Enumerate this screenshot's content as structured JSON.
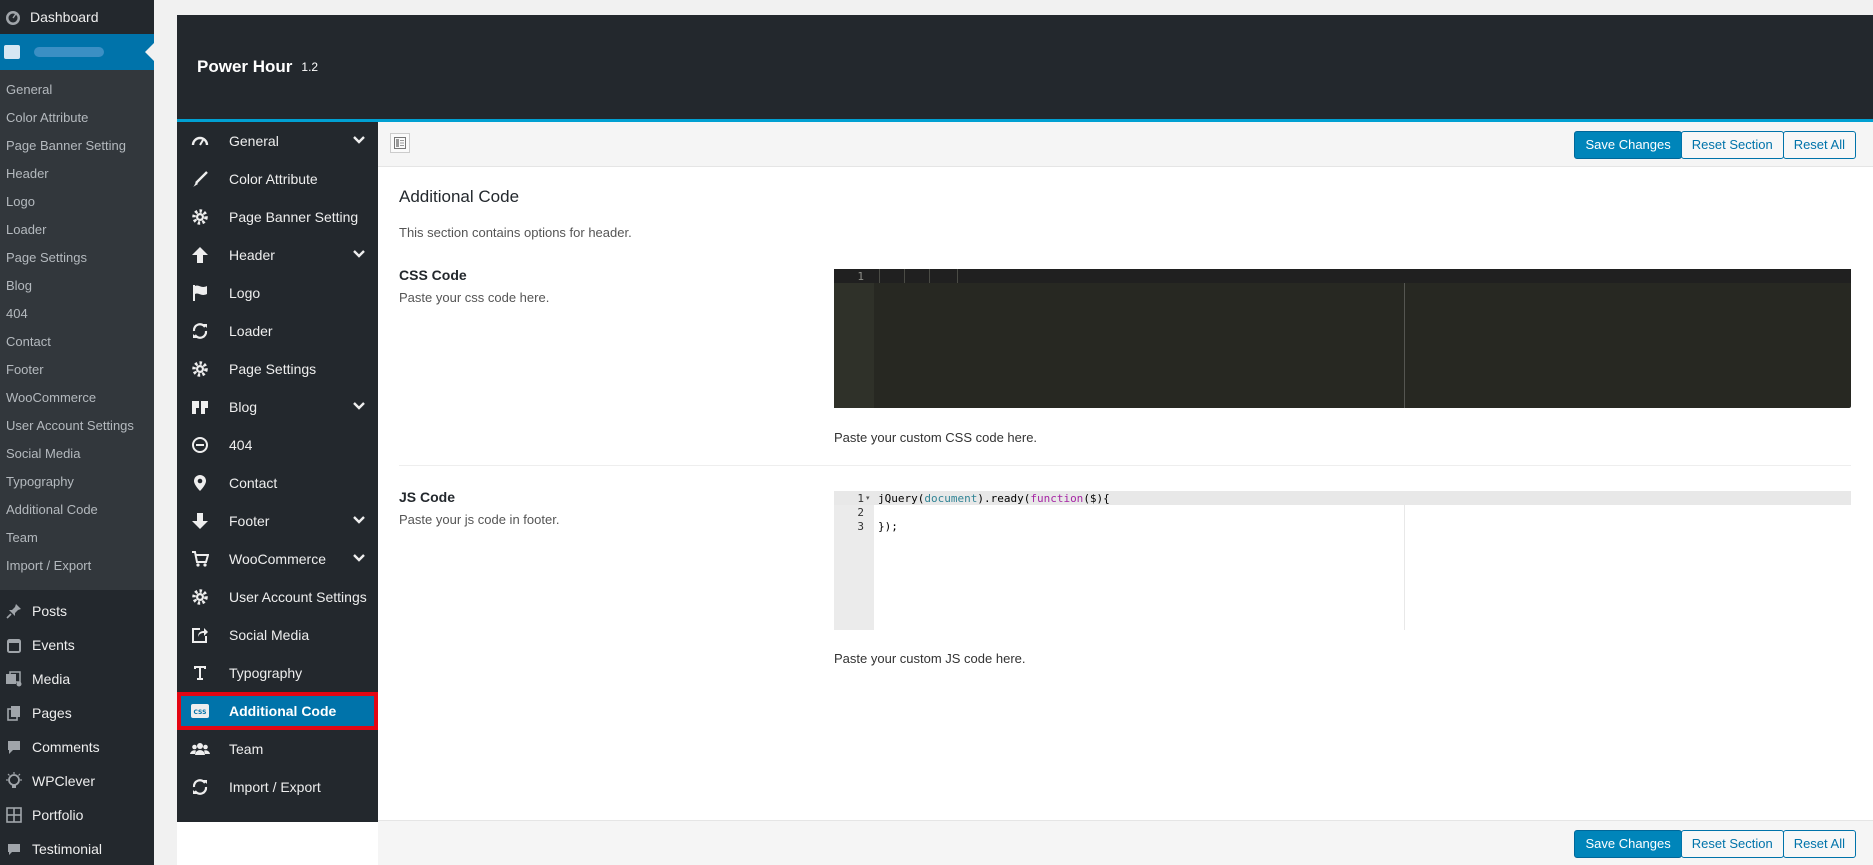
{
  "wp_menu": {
    "dashboard": "Dashboard",
    "submenu": [
      "General",
      "Color Attribute",
      "Page Banner Setting",
      "Header",
      "Logo",
      "Loader",
      "Page Settings",
      "Blog",
      "404",
      "Contact",
      "Footer",
      "WooCommerce",
      "User Account Settings",
      "Social Media",
      "Typography",
      "Additional Code",
      "Team",
      "Import / Export"
    ],
    "items": [
      {
        "label": "Posts",
        "icon": "pin-icon"
      },
      {
        "label": "Events",
        "icon": "calendar-icon"
      },
      {
        "label": "Media",
        "icon": "media-icon"
      },
      {
        "label": "Pages",
        "icon": "pages-icon"
      },
      {
        "label": "Comments",
        "icon": "comments-icon"
      },
      {
        "label": "WPClever",
        "icon": "wpclever-icon"
      },
      {
        "label": "Portfolio",
        "icon": "portfolio-icon"
      },
      {
        "label": "Testimonial",
        "icon": "testimonial-icon"
      }
    ]
  },
  "panel": {
    "title": "Power Hour",
    "version": "1.2"
  },
  "redux_menu": [
    {
      "label": "General",
      "icon": "gauge-icon",
      "expandable": true
    },
    {
      "label": "Color Attribute",
      "icon": "brush-icon",
      "expandable": false
    },
    {
      "label": "Page Banner Setting",
      "icon": "gear-icon",
      "expandable": false
    },
    {
      "label": "Header",
      "icon": "arrow-up-icon",
      "expandable": true
    },
    {
      "label": "Logo",
      "icon": "flag-icon",
      "expandable": false
    },
    {
      "label": "Loader",
      "icon": "refresh-icon",
      "expandable": false
    },
    {
      "label": "Page Settings",
      "icon": "gear-icon",
      "expandable": false
    },
    {
      "label": "Blog",
      "icon": "quote-icon",
      "expandable": true
    },
    {
      "label": "404",
      "icon": "minus-circle-icon",
      "expandable": false
    },
    {
      "label": "Contact",
      "icon": "location-pin-icon",
      "expandable": false
    },
    {
      "label": "Footer",
      "icon": "arrow-down-icon",
      "expandable": true
    },
    {
      "label": "WooCommerce",
      "icon": "cart-icon",
      "expandable": true
    },
    {
      "label": "User Account Settings",
      "icon": "gear-icon",
      "expandable": false
    },
    {
      "label": "Social Media",
      "icon": "share-icon",
      "expandable": false
    },
    {
      "label": "Typography",
      "icon": "text-icon",
      "expandable": false
    },
    {
      "label": "Additional Code",
      "icon": "css-icon",
      "expandable": false,
      "active": true
    },
    {
      "label": "Team",
      "icon": "group-icon",
      "expandable": false
    },
    {
      "label": "Import / Export",
      "icon": "refresh-icon",
      "expandable": false
    }
  ],
  "toolbar": {
    "save": "Save Changes",
    "reset_section": "Reset Section",
    "reset_all": "Reset All"
  },
  "section": {
    "title": "Additional Code",
    "description": "This section contains options for header."
  },
  "css_field": {
    "label": "CSS Code",
    "subtitle": "Paste your css code here.",
    "hint": "Paste your custom CSS code here.",
    "line_numbers": [
      "1"
    ]
  },
  "js_field": {
    "label": "JS Code",
    "subtitle": "Paste your js code in footer.",
    "hint": "Paste your custom JS code here.",
    "line_numbers": [
      "1",
      "2",
      "3"
    ],
    "code_line1_a": "jQuery(",
    "code_line1_b": "document",
    "code_line1_c": ").ready(",
    "code_line1_d": "function",
    "code_line1_e": "($){",
    "code_line3": "});"
  },
  "colors": {
    "accent": "#0073aa",
    "highlight": "#e30613",
    "header_border": "#00a0d2"
  }
}
